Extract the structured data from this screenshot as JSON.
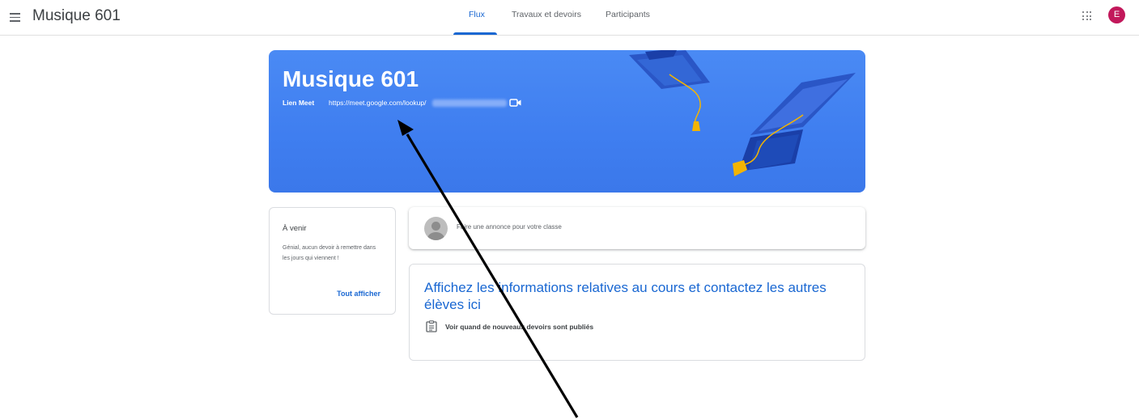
{
  "header": {
    "app_title": "Musique 601",
    "tabs": [
      {
        "label": "Flux",
        "active": true
      },
      {
        "label": "Travaux et devoirs",
        "active": false
      },
      {
        "label": "Participants",
        "active": false
      }
    ],
    "avatar_initial": "E",
    "avatar_color": "#c2185b",
    "icons": [
      "menu-icon",
      "apps-grid-icon"
    ]
  },
  "banner": {
    "title": "Musique 601",
    "meet_label": "Lien Meet",
    "meet_link": "https://meet.google.com/lookup/",
    "background_color": "#4285f4",
    "icons": [
      "video-camera-icon",
      "graduation-cap-illustration"
    ]
  },
  "upcoming": {
    "title": "À venir",
    "message": "Génial, aucun devoir à remettre dans les jours qui viennent !",
    "view_all": "Tout afficher"
  },
  "announce": {
    "placeholder": "Faire une annonce pour votre classe"
  },
  "info_card": {
    "heading": "Affichez les informations relatives au cours et contactez les autres élèves ici",
    "item": "Voir quand de nouveaux devoirs sont publiés",
    "icon": "clipboard-icon"
  },
  "accent_color": "#1967d2"
}
